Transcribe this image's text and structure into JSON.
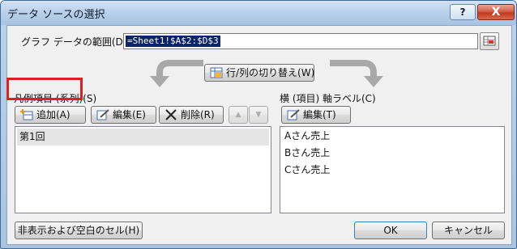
{
  "window": {
    "title": "データ ソースの選択",
    "help_label": "?",
    "close_label": "X"
  },
  "range": {
    "label": "グラフ データの範囲(D):",
    "value": "=Sheet1!$A$2:$D$3"
  },
  "switch_button": {
    "label": "行/列の切り替え(W)"
  },
  "series": {
    "label": "凡例項目 (系列)(S)",
    "add_label": "追加(A)",
    "edit_label": "編集(E)",
    "delete_label": "削除(R)",
    "up_label": "▲",
    "down_label": "▼",
    "items": [
      "第1回"
    ]
  },
  "axis": {
    "label": "横 (項目) 軸ラベル(C)",
    "edit_label": "編集(T)",
    "items": [
      "Aさん売上",
      "Bさん売上",
      "Cさん売上"
    ]
  },
  "footer": {
    "hidden_cells_label": "非表示および空白のセル(H)",
    "ok_label": "OK",
    "cancel_label": "キャンセル"
  },
  "colors": {
    "highlight": "#e02020",
    "title_bg": "#b8d0ea",
    "selection": "#0a246a"
  }
}
